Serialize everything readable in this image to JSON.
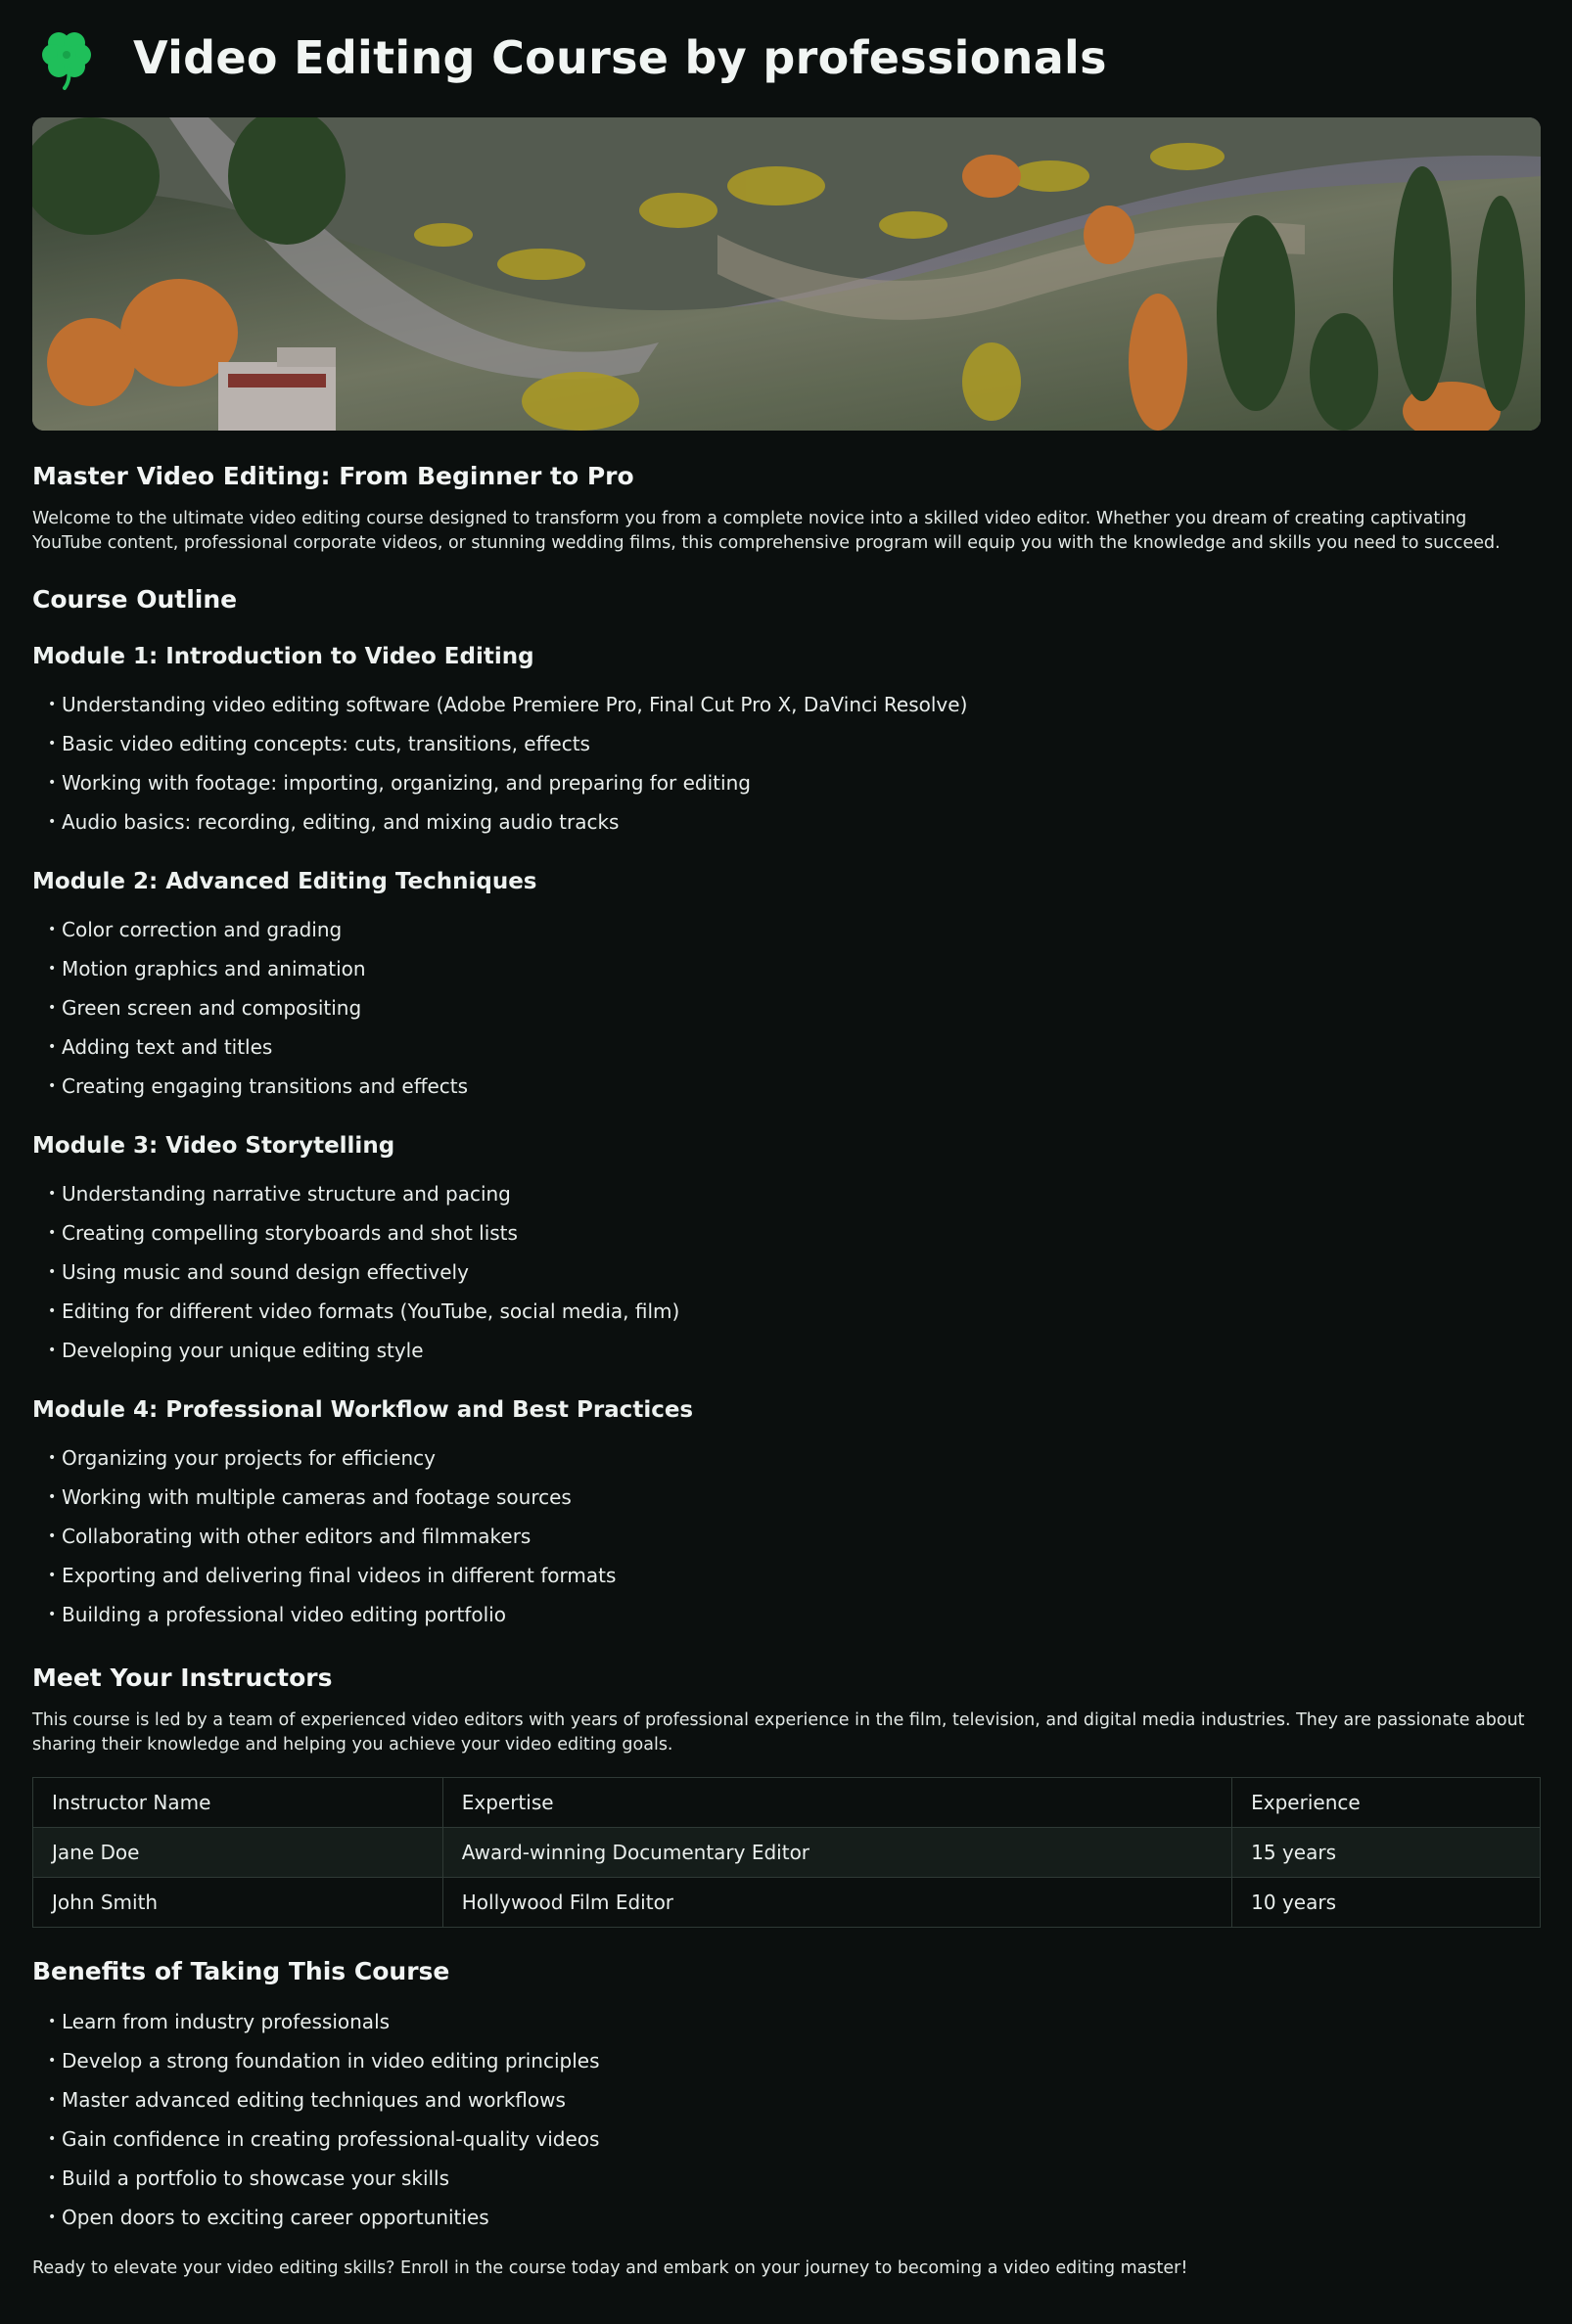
{
  "header": {
    "logo_icon": "four-leaf-clover-icon",
    "logo_color": "#22c55e",
    "title": "Video Editing Course by professionals"
  },
  "hero": {
    "image": "autumn-mountain-valley-photo"
  },
  "intro": {
    "title": "Master Video Editing: From Beginner to Pro",
    "text": "Welcome to the ultimate video editing course designed to transform you from a complete novice into a skilled video editor. Whether you dream of creating captivating YouTube content, professional corporate videos, or stunning wedding films, this comprehensive program will equip you with the knowledge and skills you need to succeed."
  },
  "outline": {
    "heading": "Course Outline",
    "modules": [
      {
        "title": "Module 1: Introduction to Video Editing",
        "items": [
          "Understanding video editing software (Adobe Premiere Pro, Final Cut Pro X, DaVinci Resolve)",
          "Basic video editing concepts: cuts, transitions, effects",
          "Working with footage: importing, organizing, and preparing for editing",
          "Audio basics: recording, editing, and mixing audio tracks"
        ]
      },
      {
        "title": "Module 2: Advanced Editing Techniques",
        "items": [
          "Color correction and grading",
          "Motion graphics and animation",
          "Green screen and compositing",
          "Adding text and titles",
          "Creating engaging transitions and effects"
        ]
      },
      {
        "title": "Module 3: Video Storytelling",
        "items": [
          "Understanding narrative structure and pacing",
          "Creating compelling storyboards and shot lists",
          "Using music and sound design effectively",
          "Editing for different video formats (YouTube, social media, film)",
          "Developing your unique editing style"
        ]
      },
      {
        "title": "Module 4: Professional Workflow and Best Practices",
        "items": [
          "Organizing your projects for efficiency",
          "Working with multiple cameras and footage sources",
          "Collaborating with other editors and filmmakers",
          "Exporting and delivering final videos in different formats",
          "Building a professional video editing portfolio"
        ]
      }
    ]
  },
  "instructors": {
    "heading": "Meet Your Instructors",
    "text": "This course is led by a team of experienced video editors with years of professional experience in the film, television, and digital media industries. They are passionate about sharing their knowledge and helping you achieve your video editing goals.",
    "columns": [
      "Instructor Name",
      "Expertise",
      "Experience"
    ],
    "rows": [
      [
        "Jane Doe",
        "Award-winning Documentary Editor",
        "15 years"
      ],
      [
        "John Smith",
        "Hollywood Film Editor",
        "10 years"
      ]
    ]
  },
  "benefits": {
    "heading": "Benefits of Taking This Course",
    "items": [
      "Learn from industry professionals",
      "Develop a strong foundation in video editing principles",
      "Master advanced editing techniques and workflows",
      "Gain confidence in creating professional-quality videos",
      "Build a portfolio to showcase your skills",
      "Open doors to exciting career opportunities"
    ]
  },
  "closing": "Ready to elevate your video editing skills? Enroll in the course today and embark on your journey to becoming a video editing master!"
}
